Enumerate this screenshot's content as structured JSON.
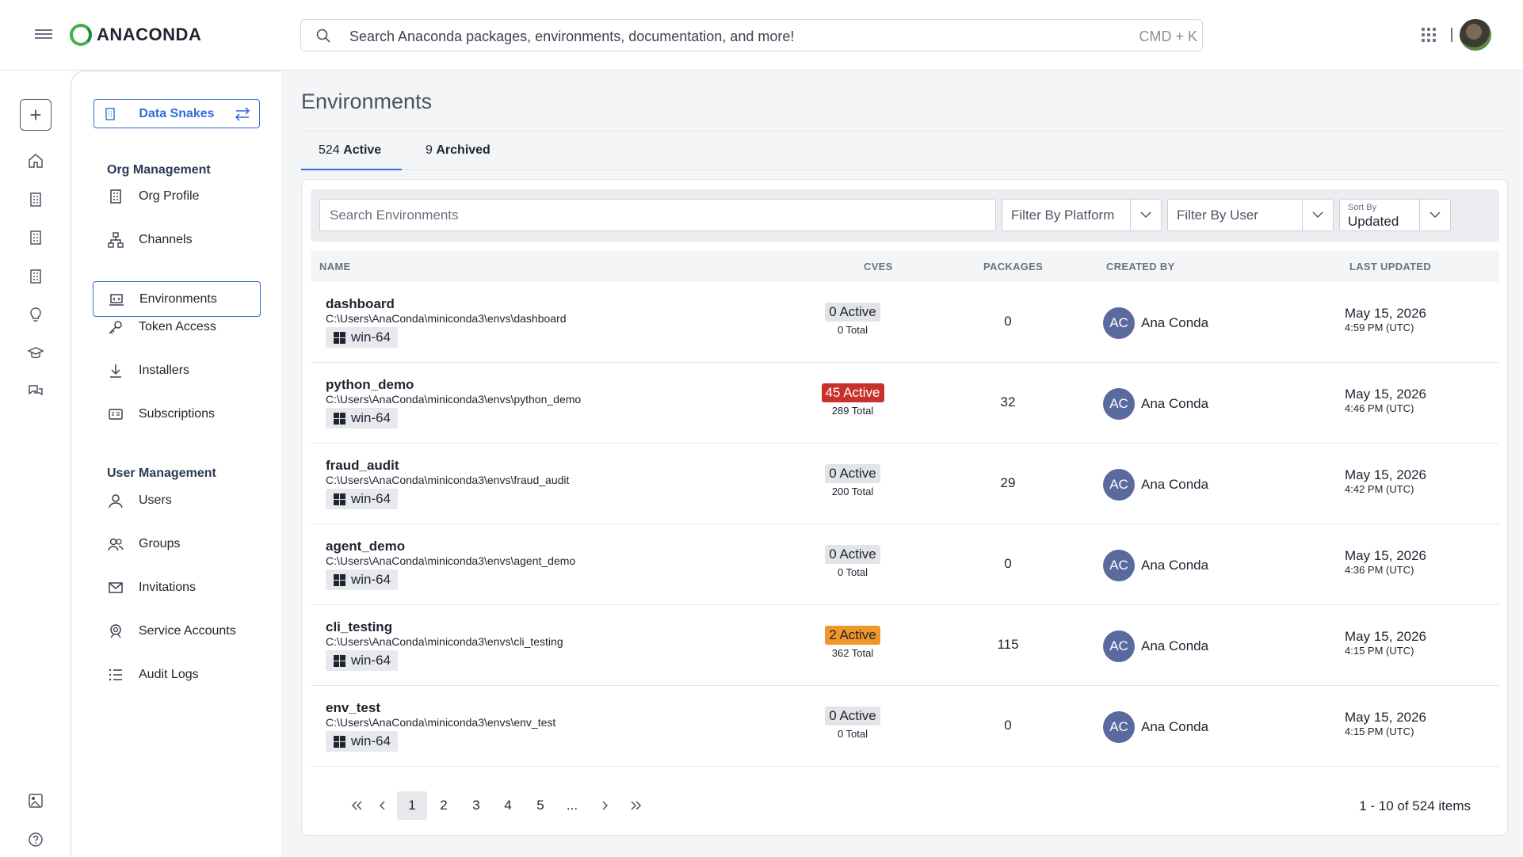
{
  "header": {
    "brand": "ANACONDA",
    "search_placeholder": "Search Anaconda packages, environments, documentation, and more!",
    "search_shortcut": "CMD + K"
  },
  "rail": {
    "icons": [
      "plus-icon",
      "home-icon",
      "building-icon",
      "building-icon",
      "building-icon",
      "lightbulb-icon",
      "graduation-cap-icon",
      "chat-icon",
      "image-icon",
      "help-icon"
    ]
  },
  "sidebar": {
    "org_name": "Data Snakes",
    "sections": [
      {
        "title": "Org Management"
      },
      {
        "title": "User Management"
      }
    ],
    "items": [
      {
        "label": "Org Profile",
        "icon": "building-icon"
      },
      {
        "label": "Channels",
        "icon": "channels-icon"
      },
      {
        "label": "Environments",
        "icon": "laptop-icon"
      },
      {
        "label": "Token Access",
        "icon": "key-icon"
      },
      {
        "label": "Installers",
        "icon": "download-icon"
      },
      {
        "label": "Subscriptions",
        "icon": "card-icon"
      },
      {
        "label": "Users",
        "icon": "user-icon"
      },
      {
        "label": "Groups",
        "icon": "users-icon"
      },
      {
        "label": "Invitations",
        "icon": "envelope-icon"
      },
      {
        "label": "Service Accounts",
        "icon": "service-account-icon"
      },
      {
        "label": "Audit Logs",
        "icon": "list-icon"
      }
    ],
    "active_item": "Environments"
  },
  "main": {
    "title": "Environments",
    "tabs": [
      {
        "count": "524",
        "label": "Active"
      },
      {
        "count": "9",
        "label": "Archived"
      }
    ],
    "filters": {
      "search_placeholder": "Search Environments",
      "platform_placeholder": "Filter By Platform",
      "user_placeholder": "Filter By User",
      "sort_label": "Sort By",
      "sort_value": "Updated"
    },
    "columns": [
      "NAME",
      "CVES",
      "PACKAGES",
      "CREATED BY",
      "LAST UPDATED"
    ],
    "rows": [
      {
        "name": "dashboard",
        "path": "C:\\Users\\AnaConda\\miniconda3\\envs\\dashboard",
        "platform": "win-64",
        "cve_active": "0 Active",
        "cve_total": "0 Total",
        "cve_level": "none",
        "packages": "0",
        "initials": "AC",
        "creator": "Ana Conda",
        "date": "May 15, 2026",
        "time": "4:59 PM (UTC)"
      },
      {
        "name": "python_demo",
        "path": "C:\\Users\\AnaConda\\miniconda3\\envs\\python_demo",
        "platform": "win-64",
        "cve_active": "45 Active",
        "cve_total": "289 Total",
        "cve_level": "red",
        "packages": "32",
        "initials": "AC",
        "creator": "Ana Conda",
        "date": "May 15, 2026",
        "time": "4:46 PM (UTC)"
      },
      {
        "name": "fraud_audit",
        "path": "C:\\Users\\AnaConda\\miniconda3\\envs\\fraud_audit",
        "platform": "win-64",
        "cve_active": "0 Active",
        "cve_total": "200 Total",
        "cve_level": "none",
        "packages": "29",
        "initials": "AC",
        "creator": "Ana Conda",
        "date": "May 15, 2026",
        "time": "4:42 PM (UTC)"
      },
      {
        "name": "agent_demo",
        "path": "C:\\Users\\AnaConda\\miniconda3\\envs\\agent_demo",
        "platform": "win-64",
        "cve_active": "0 Active",
        "cve_total": "0 Total",
        "cve_level": "none",
        "packages": "0",
        "initials": "AC",
        "creator": "Ana Conda",
        "date": "May 15, 2026",
        "time": "4:36 PM (UTC)"
      },
      {
        "name": "cli_testing",
        "path": "C:\\Users\\AnaConda\\miniconda3\\envs\\cli_testing",
        "platform": "win-64",
        "cve_active": "2 Active",
        "cve_total": "362 Total",
        "cve_level": "orange",
        "packages": "115",
        "initials": "AC",
        "creator": "Ana Conda",
        "date": "May 15, 2026",
        "time": "4:15 PM (UTC)"
      },
      {
        "name": "env_test",
        "path": "C:\\Users\\AnaConda\\miniconda3\\envs\\env_test",
        "platform": "win-64",
        "cve_active": "0 Active",
        "cve_total": "0 Total",
        "cve_level": "none",
        "packages": "0",
        "initials": "AC",
        "creator": "Ana Conda",
        "date": "May 15, 2026",
        "time": "4:15 PM (UTC)"
      }
    ],
    "pagination": {
      "pages": [
        "1",
        "2",
        "3",
        "4",
        "5",
        "..."
      ],
      "current": "1",
      "summary": "1 - 10 of 524 items"
    }
  },
  "colors": {
    "accent": "#2f6fd6",
    "cve_red": "#c7322c",
    "cve_orange": "#f0962a",
    "avatar": "#5b6a9e"
  }
}
